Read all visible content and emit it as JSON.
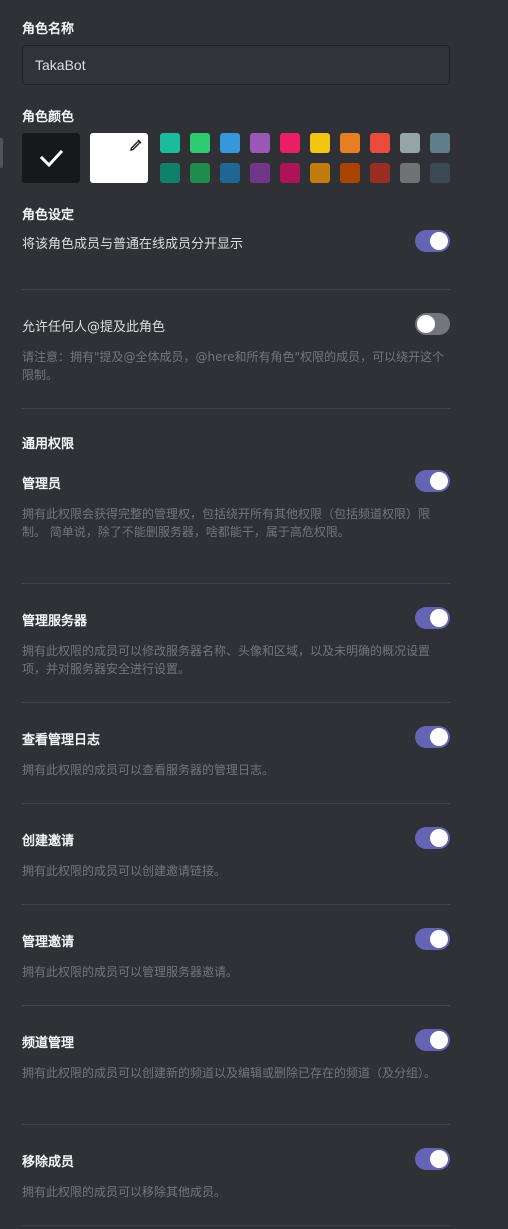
{
  "role_name": {
    "title": "角色名称",
    "value": "TakaBot"
  },
  "role_color": {
    "title": "角色颜色",
    "swatches_top": [
      "#1abc9c",
      "#2ecc71",
      "#3498db",
      "#9b59b6",
      "#e91e63",
      "#f1c40f",
      "#e67e22",
      "#e74c3c",
      "#95a5a6",
      "#607d8b"
    ],
    "swatches_bottom": [
      "#11806a",
      "#1f8b4c",
      "#206694",
      "#71368a",
      "#ad1457",
      "#c27c0e",
      "#a84300",
      "#992d22",
      "#6f7375",
      "#3b4a54"
    ]
  },
  "role_settings": {
    "title": "角色设定",
    "separate": {
      "label": "将该角色成员与普通在线成员分开显示",
      "enabled": true
    },
    "mention": {
      "label": "允许任何人@提及此角色",
      "enabled": false,
      "note": "请注意：拥有\"提及@全体成员，@here和所有角色\"权限的成员，可以绕开这个限制。"
    }
  },
  "permissions": {
    "title": "通用权限",
    "items": [
      {
        "label": "管理员",
        "desc": "拥有此权限会获得完整的管理权，包括绕开所有其他权限（包括频道权限）限制。 简单说，除了不能删服务器，啥都能干，属于高危权限。",
        "enabled": true
      },
      {
        "label": "管理服务器",
        "desc": "拥有此权限的成员可以修改服务器名称、头像和区域，以及未明确的概况设置项，并对服务器安全进行设置。",
        "enabled": true
      },
      {
        "label": "查看管理日志",
        "desc": "拥有此权限的成员可以查看服务器的管理日志。",
        "enabled": true
      },
      {
        "label": "创建邀请",
        "desc": "拥有此权限的成员可以创建邀请链接。",
        "enabled": true
      },
      {
        "label": "管理邀请",
        "desc": "拥有此权限的成员可以管理服务器邀请。",
        "enabled": true
      },
      {
        "label": "频道管理",
        "desc": "拥有此权限的成员可以创建新的频道以及编辑或删除已存在的频道（及分组）。",
        "enabled": true
      },
      {
        "label": "移除成员",
        "desc": "拥有此权限的成员可以移除其他成员。",
        "enabled": true
      }
    ]
  }
}
